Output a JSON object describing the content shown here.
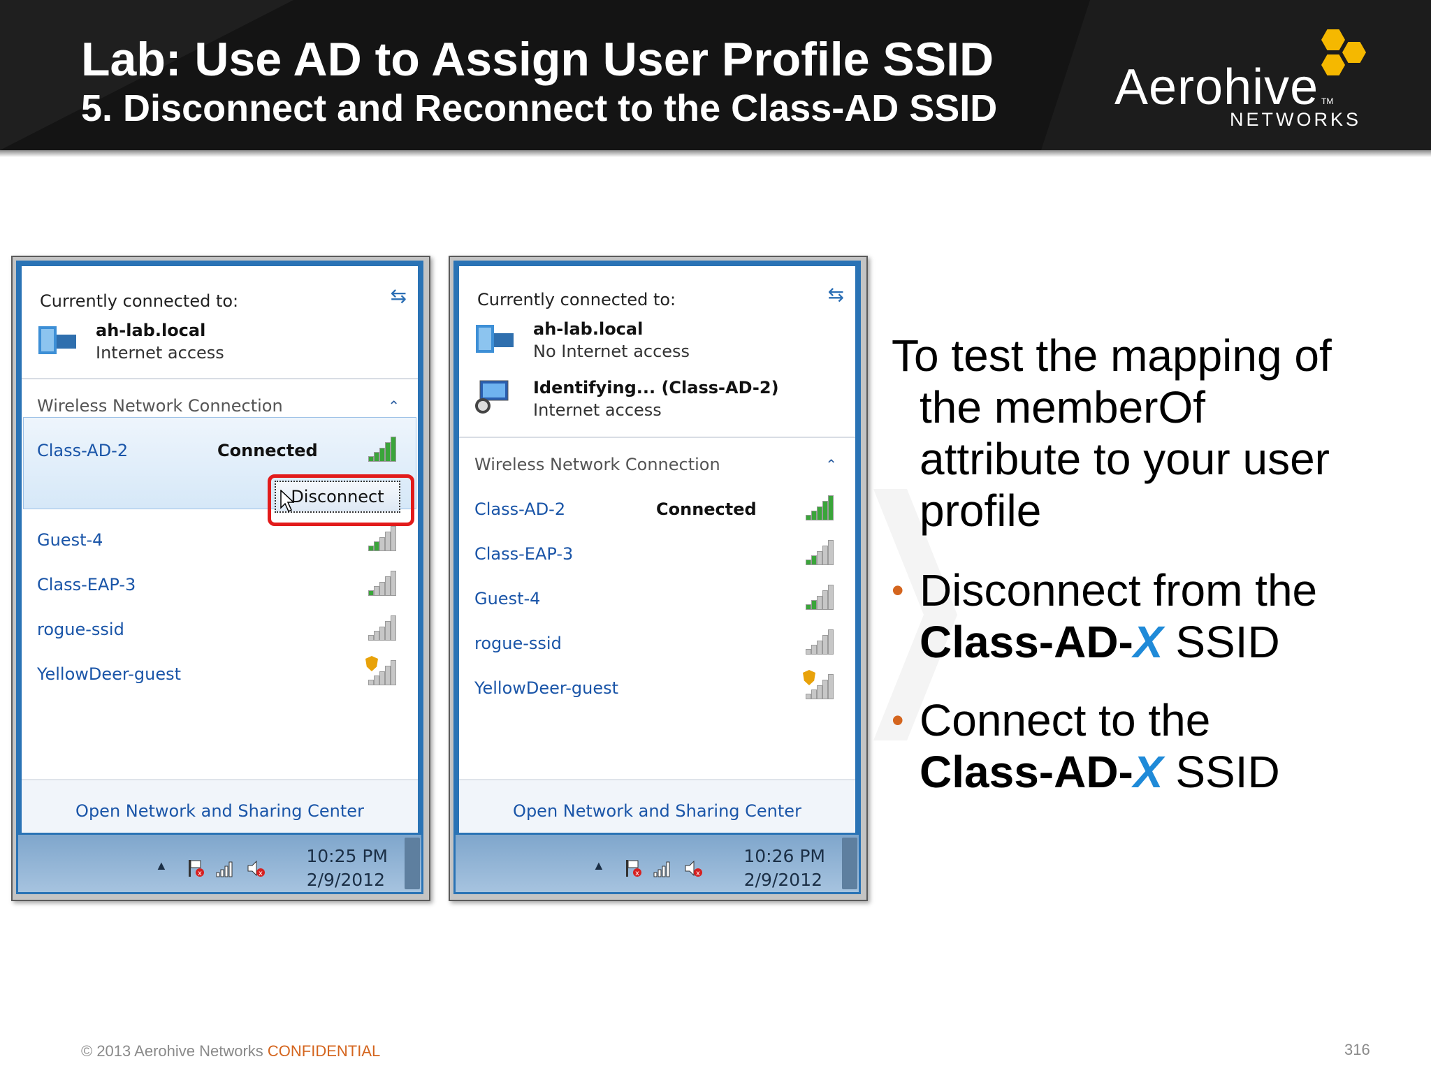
{
  "header": {
    "title": "Lab: Use AD to Assign User Profile SSID",
    "subtitle": "5. Disconnect and Reconnect to the Class-AD SSID",
    "logo_main": "Aerohive",
    "logo_tm": "TM",
    "logo_sub": "NETWORKS"
  },
  "left_panel": {
    "currently_connected_label": "Currently connected to:",
    "network": {
      "name": "ah-lab.local",
      "status": "Internet access"
    },
    "section_label": "Wireless Network Connection",
    "selected": {
      "ssid": "Class-AD-2",
      "status": "Connected",
      "disconnect_label": "Disconnect"
    },
    "others": [
      {
        "ssid": "Guest-4",
        "bars": 2,
        "secure": false
      },
      {
        "ssid": "Class-EAP-3",
        "bars": 1,
        "secure": false
      },
      {
        "ssid": "rogue-ssid",
        "bars": 0,
        "secure": false
      },
      {
        "ssid": "YellowDeer-guest",
        "bars": 0,
        "secure": true
      }
    ],
    "open_center": "Open Network and Sharing Center",
    "clock": {
      "time": "10:25 PM",
      "date": "2/9/2012"
    }
  },
  "right_panel": {
    "currently_connected_label": "Currently connected to:",
    "network1": {
      "name": "ah-lab.local",
      "status": "No Internet access"
    },
    "network2": {
      "name": "Identifying... (Class-AD-2)",
      "status": "Internet access"
    },
    "section_label": "Wireless Network Connection",
    "list": [
      {
        "ssid": "Class-AD-2",
        "status": "Connected",
        "bars": 5,
        "secure": false
      },
      {
        "ssid": "Class-EAP-3",
        "status": "",
        "bars": 2,
        "secure": false
      },
      {
        "ssid": "Guest-4",
        "status": "",
        "bars": 2,
        "secure": false
      },
      {
        "ssid": "rogue-ssid",
        "status": "",
        "bars": 0,
        "secure": false
      },
      {
        "ssid": "YellowDeer-guest",
        "status": "",
        "bars": 0,
        "secure": true
      }
    ],
    "open_center": "Open Network and Sharing Center",
    "clock": {
      "time": "10:26 PM",
      "date": "2/9/2012"
    }
  },
  "content": {
    "intro_line1": "To test the mapping of",
    "intro_line2": "the memberOf",
    "intro_line3": "attribute to your user",
    "intro_line4": "profile",
    "bullet1_line1": "Disconnect from the",
    "bullet1_bold": "Class-AD-",
    "bullet1_x": "X",
    "bullet1_tail": " SSID",
    "bullet2_line1": "Connect to the",
    "bullet2_bold": "Class-AD-",
    "bullet2_x": "X",
    "bullet2_tail": " SSID",
    "bullet_char": "•"
  },
  "footer": {
    "copyright": "© 2013 Aerohive Networks ",
    "confidential": "CONFIDENTIAL",
    "page": "316"
  },
  "colors": {
    "accent_orange": "#d4651e",
    "x_blue": "#1f8ad8",
    "link_blue": "#1a55a8",
    "highlight_red": "#e21b1b"
  }
}
